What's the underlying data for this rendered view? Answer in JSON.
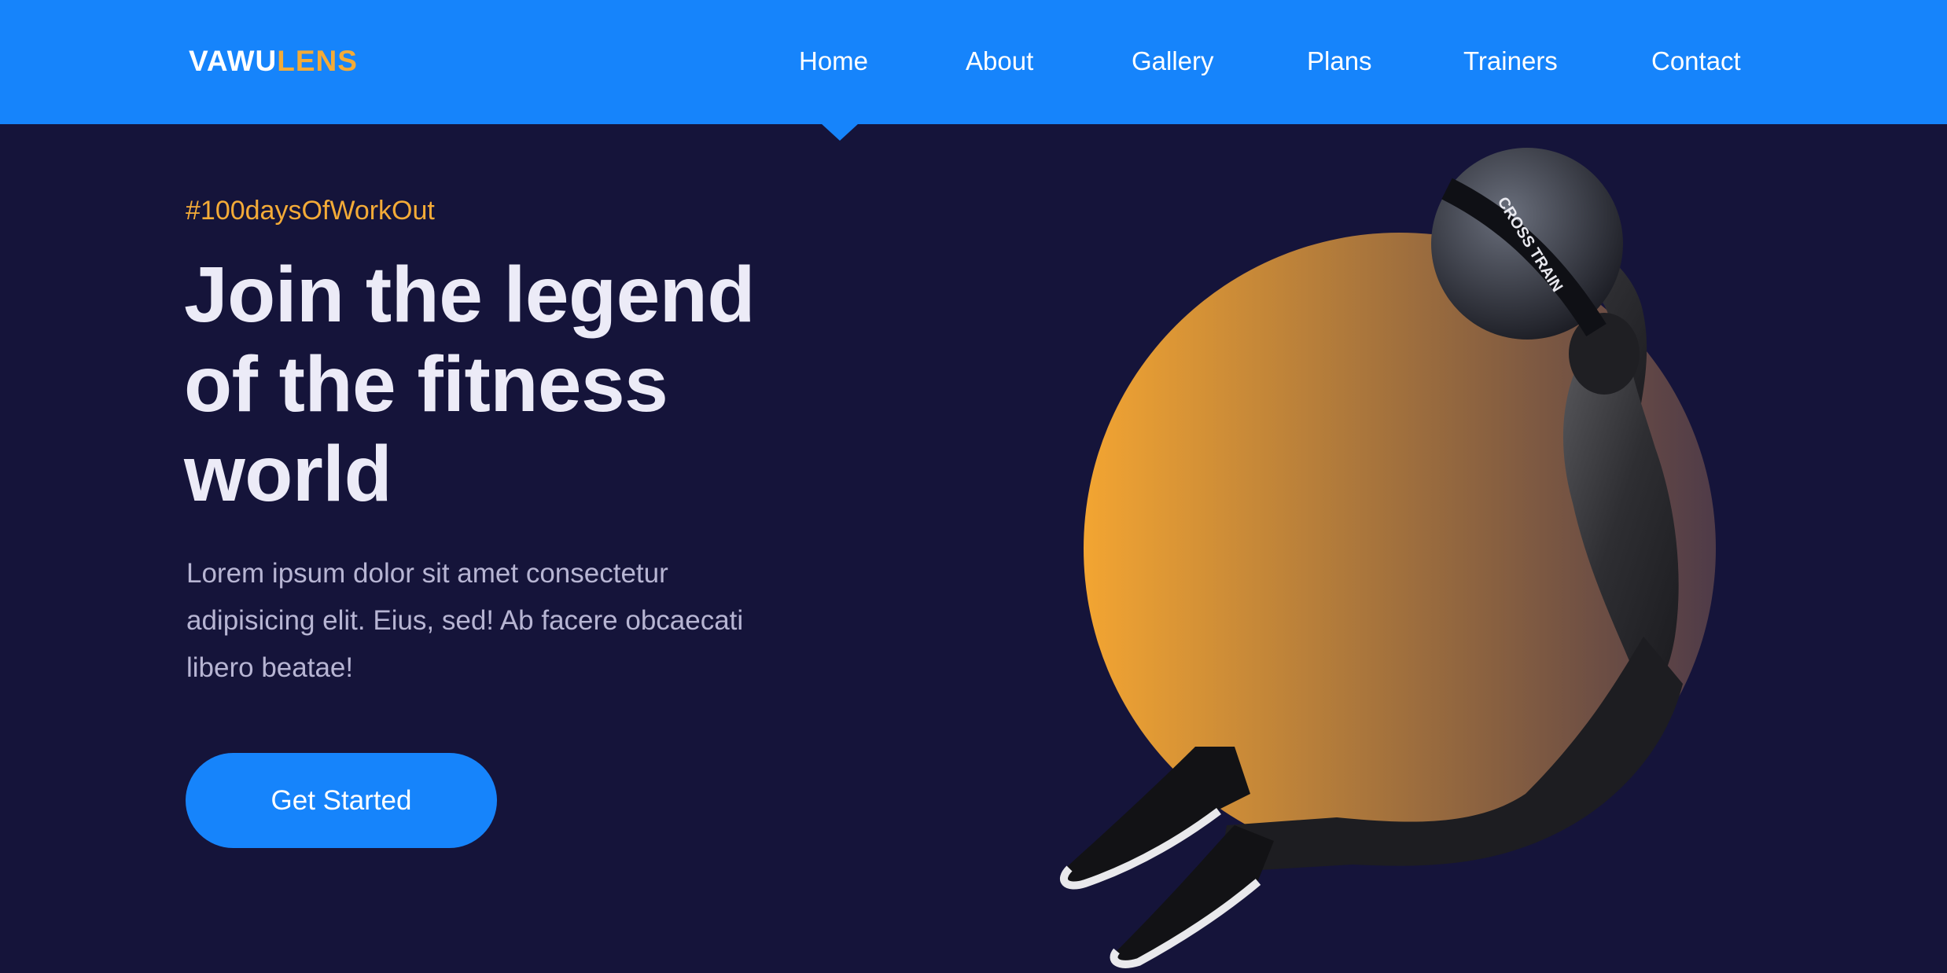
{
  "brand": {
    "part1": "VAWU",
    "part2": "LENS"
  },
  "nav": {
    "items": [
      {
        "label": "Home"
      },
      {
        "label": "About"
      },
      {
        "label": "Gallery"
      },
      {
        "label": "Plans"
      },
      {
        "label": "Trainers"
      },
      {
        "label": "Contact"
      }
    ],
    "active": "Home"
  },
  "hero": {
    "hashtag": "#100daysOfWorkOut",
    "headline": [
      "Join the legend",
      "of the fitness",
      "world"
    ],
    "paragraph": [
      "Lorem ipsum dolor sit amet consectetur",
      "adipisicing elit. Eius, sed! Ab facere obcaecati",
      "libero beatae!"
    ],
    "cta_label": "Get Started",
    "ball_label": "CROSS TRAIN"
  },
  "colors": {
    "nav_bg": "#1684fb",
    "page_bg": "#15143a",
    "accent": "#f4ab37",
    "headline": "#ecebf7",
    "body_text": "#b7b5d3",
    "circle_gradient_start": "#f3a532",
    "circle_gradient_end": "#4f3b48"
  }
}
